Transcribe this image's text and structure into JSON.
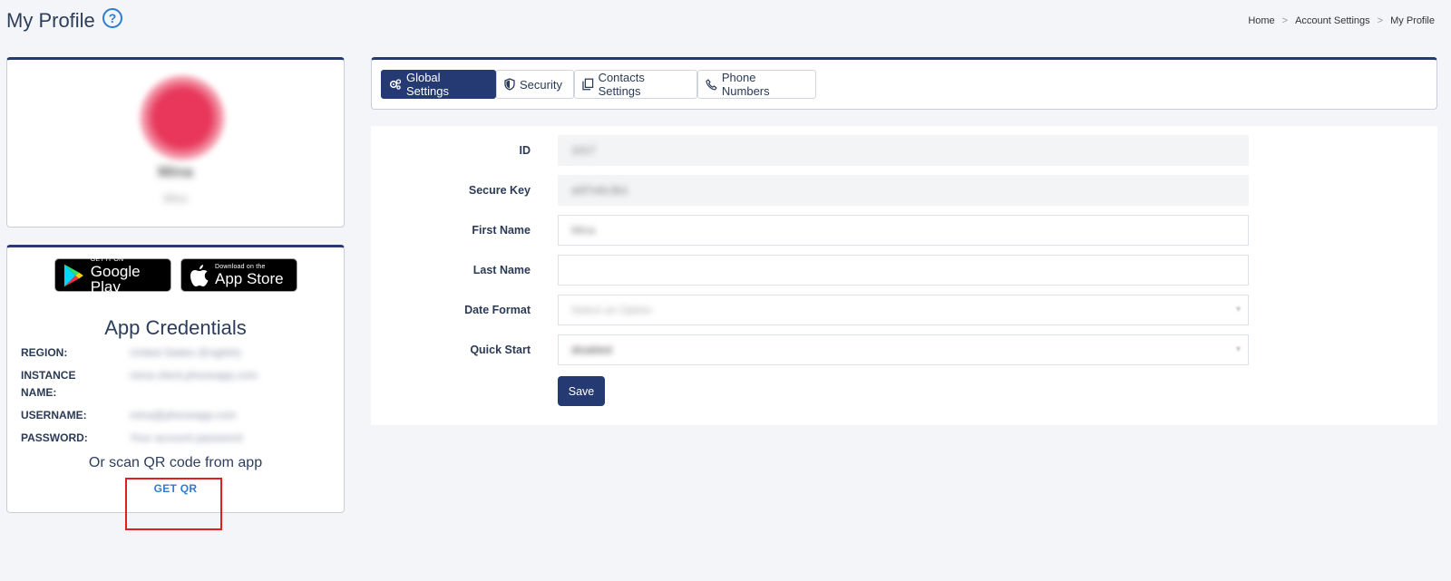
{
  "header": {
    "title": "My Profile",
    "help_icon": "?",
    "breadcrumb": [
      "Home",
      "Account Settings",
      "My Profile"
    ],
    "breadcrumb_sep": ">"
  },
  "profile": {
    "name": "Mina",
    "subtitle": "Mina",
    "avatar_color": "#e8375a"
  },
  "app_badges": {
    "google_small": "GET IT ON",
    "google_big": "Google Play",
    "apple_small": "Download on the",
    "apple_big": "App Store"
  },
  "credentials": {
    "title": "App Credentials",
    "rows": [
      {
        "label": "REGION:",
        "value": "United States (English)"
      },
      {
        "label": "INSTANCE NAME:",
        "value": "mina-client.phoneapp.com"
      },
      {
        "label": "USERNAME:",
        "value": "mina@phoneapp.com"
      },
      {
        "label": "PASSWORD:",
        "value": "Your account password"
      }
    ],
    "scan_text": "Or scan QR code from app",
    "get_qr": "GET QR"
  },
  "tabs": [
    {
      "label": "Global Settings",
      "icon": "gears-icon",
      "active": true
    },
    {
      "label": "Security",
      "icon": "shield-icon",
      "active": false
    },
    {
      "label": "Contacts Settings",
      "icon": "copy-icon",
      "active": false
    },
    {
      "label": "Phone Numbers",
      "icon": "phone-icon",
      "active": false
    }
  ],
  "form": {
    "fields": [
      {
        "label": "ID",
        "value": "1017"
      },
      {
        "label": "Secure Key",
        "value": "a0f7e6c3b1"
      },
      {
        "label": "First Name",
        "value": "Mina"
      },
      {
        "label": "Last Name",
        "value": ""
      },
      {
        "label": "Date Format",
        "value": "Select an Option"
      },
      {
        "label": "Quick Start",
        "value": "disabled"
      }
    ],
    "save_label": "Save"
  },
  "colors": {
    "primary": "#253a73",
    "link": "#2d7dd2",
    "highlight": "#e02020"
  }
}
